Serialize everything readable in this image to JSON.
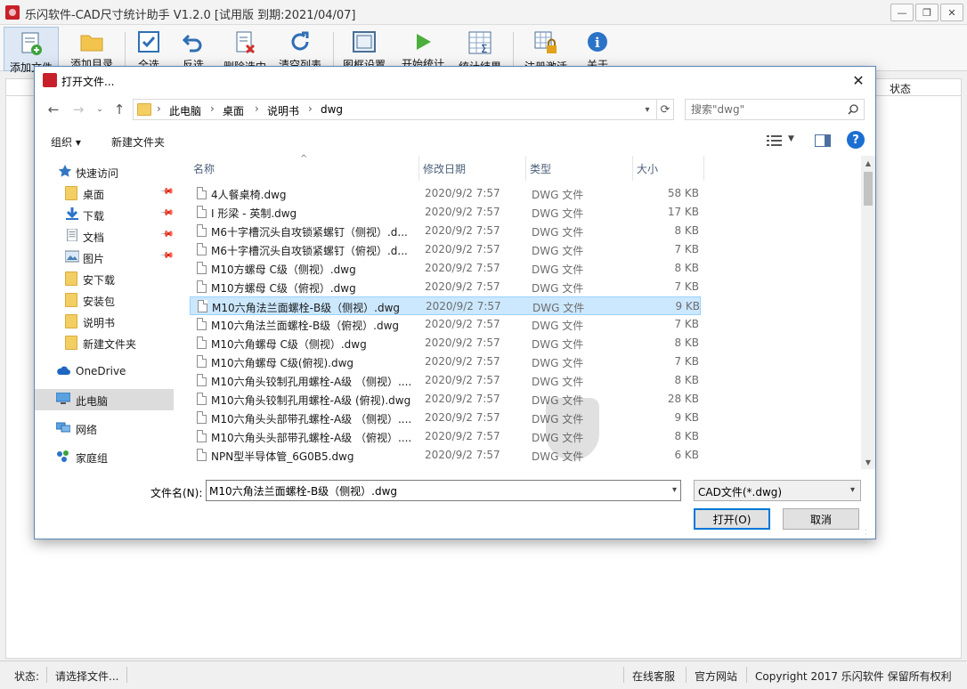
{
  "app": {
    "title": "乐闪软件-CAD尺寸统计助手 V1.2.0 [试用版 到期:2021/04/07]",
    "window_buttons": [
      "—",
      "❐",
      "✕"
    ],
    "toolbar": [
      {
        "label": "添加文件",
        "icon": "add-file-icon"
      },
      {
        "label": "添加目录",
        "icon": "folder-icon"
      },
      {
        "label": "全选",
        "icon": "checkbox-icon"
      },
      {
        "label": "反选",
        "icon": "undo-icon"
      },
      {
        "label": "删除选中",
        "icon": "delete-doc-icon"
      },
      {
        "label": "清空列表",
        "icon": "refresh-icon"
      },
      {
        "label": "图框设置",
        "icon": "frame-icon"
      },
      {
        "label": "开始统计",
        "icon": "play-icon"
      },
      {
        "label": "统计结果",
        "icon": "sum-table-icon"
      },
      {
        "label": "注册激活",
        "icon": "lock-grid-icon"
      },
      {
        "label": "关于",
        "icon": "info-icon"
      }
    ],
    "list_header_status": "状态",
    "statusbar": {
      "status_label": "状态:",
      "status_text": "请选择文件...",
      "links": [
        "在线客服",
        "官方网站"
      ],
      "copyright": "Copyright 2017 乐闪软件 保留所有权利"
    }
  },
  "dialog": {
    "title": "打开文件...",
    "close": "✕",
    "breadcrumb": [
      "此电脑",
      "桌面",
      "说明书",
      "dwg"
    ],
    "search_placeholder": "搜索\"dwg\"",
    "commands": {
      "organize": "组织 ▾",
      "new_folder": "新建文件夹"
    },
    "help": "?",
    "nav_items": [
      {
        "label": "快速访问",
        "icon": "star-icon",
        "pinned": false,
        "indent": 1
      },
      {
        "label": "桌面",
        "icon": "folder-icon",
        "pinned": true,
        "indent": 2
      },
      {
        "label": "下载",
        "icon": "download-icon",
        "pinned": true,
        "indent": 2
      },
      {
        "label": "文档",
        "icon": "document-icon",
        "pinned": true,
        "indent": 2
      },
      {
        "label": "图片",
        "icon": "picture-icon",
        "pinned": true,
        "indent": 2
      },
      {
        "label": "安下载",
        "icon": "folder-icon",
        "pinned": false,
        "indent": 2
      },
      {
        "label": "安装包",
        "icon": "folder-icon",
        "pinned": false,
        "indent": 2
      },
      {
        "label": "说明书",
        "icon": "folder-icon",
        "pinned": false,
        "indent": 2
      },
      {
        "label": "新建文件夹",
        "icon": "folder-icon",
        "pinned": false,
        "indent": 2
      },
      {
        "label": "OneDrive",
        "icon": "cloud-icon",
        "pinned": false,
        "indent": 1
      },
      {
        "label": "此电脑",
        "icon": "computer-icon",
        "pinned": false,
        "indent": 1,
        "selected": true
      },
      {
        "label": "网络",
        "icon": "network-icon",
        "pinned": false,
        "indent": 1
      },
      {
        "label": "家庭组",
        "icon": "homegroup-icon",
        "pinned": false,
        "indent": 1
      }
    ],
    "columns": [
      "名称",
      "修改日期",
      "类型",
      "大小"
    ],
    "files": [
      {
        "name": "4人餐桌椅.dwg",
        "date": "2020/9/2 7:57",
        "type": "DWG 文件",
        "size": "58 KB"
      },
      {
        "name": "I 形梁 - 英制.dwg",
        "date": "2020/9/2 7:57",
        "type": "DWG 文件",
        "size": "17 KB"
      },
      {
        "name": "M6十字槽沉头自攻锁紧螺钉（侧视）.d...",
        "date": "2020/9/2 7:57",
        "type": "DWG 文件",
        "size": "8 KB"
      },
      {
        "name": "M6十字槽沉头自攻锁紧螺钉（俯视）.d...",
        "date": "2020/9/2 7:57",
        "type": "DWG 文件",
        "size": "7 KB"
      },
      {
        "name": "M10方螺母 C级（侧视）.dwg",
        "date": "2020/9/2 7:57",
        "type": "DWG 文件",
        "size": "8 KB"
      },
      {
        "name": "M10方螺母 C级（俯视）.dwg",
        "date": "2020/9/2 7:57",
        "type": "DWG 文件",
        "size": "7 KB"
      },
      {
        "name": "M10六角法兰面螺栓-B级（侧视）.dwg",
        "date": "2020/9/2 7:57",
        "type": "DWG 文件",
        "size": "9 KB",
        "selected": true
      },
      {
        "name": "M10六角法兰面螺栓-B级（俯视）.dwg",
        "date": "2020/9/2 7:57",
        "type": "DWG 文件",
        "size": "7 KB"
      },
      {
        "name": "M10六角螺母 C级（侧视）.dwg",
        "date": "2020/9/2 7:57",
        "type": "DWG 文件",
        "size": "8 KB"
      },
      {
        "name": "M10六角螺母 C级(俯视).dwg",
        "date": "2020/9/2 7:57",
        "type": "DWG 文件",
        "size": "7 KB"
      },
      {
        "name": "M10六角头铰制孔用螺栓-A级 （侧视）....",
        "date": "2020/9/2 7:57",
        "type": "DWG 文件",
        "size": "8 KB"
      },
      {
        "name": "M10六角头铰制孔用螺栓-A级 (俯视).dwg",
        "date": "2020/9/2 7:57",
        "type": "DWG 文件",
        "size": "28 KB"
      },
      {
        "name": "M10六角头头部带孔螺栓-A级 （侧视）....",
        "date": "2020/9/2 7:57",
        "type": "DWG 文件",
        "size": "9 KB"
      },
      {
        "name": "M10六角头头部带孔螺栓-A级 （俯视）....",
        "date": "2020/9/2 7:57",
        "type": "DWG 文件",
        "size": "8 KB"
      },
      {
        "name": "NPN型半导体管_6G0B5.dwg",
        "date": "2020/9/2 7:57",
        "type": "DWG 文件",
        "size": "6 KB"
      }
    ],
    "filename_label": "文件名(N):",
    "filename_value": "M10六角法兰面螺栓-B级（侧视）.dwg",
    "filetype_value": "CAD文件(*.dwg)",
    "open_button": "打开(O)",
    "cancel_button": "取消"
  },
  "colors": {
    "accent": "#0078d7",
    "selection": "#cce8ff",
    "brand": "#c8202a"
  }
}
